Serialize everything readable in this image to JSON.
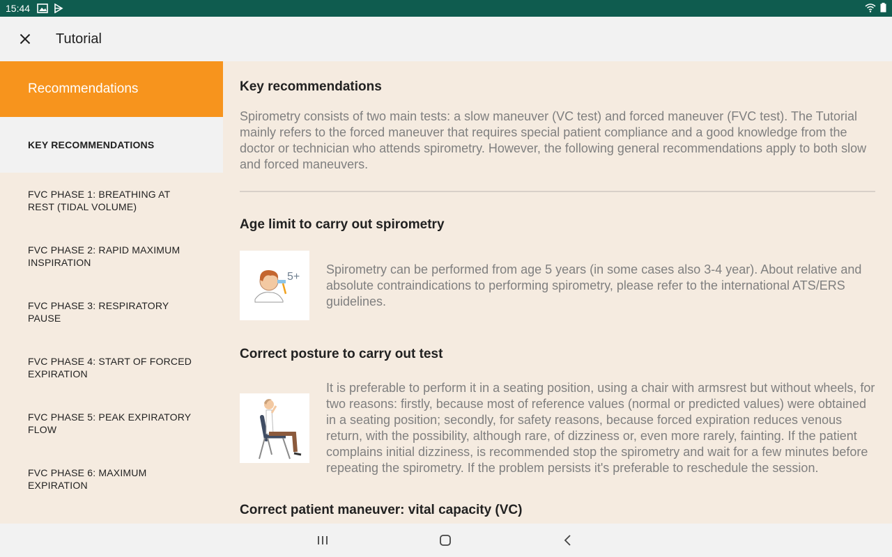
{
  "status_bar": {
    "time": "15:44"
  },
  "app_bar": {
    "title": "Tutorial"
  },
  "sidebar": {
    "header": "Recommendations",
    "items": [
      {
        "label": "KEY RECOMMENDATIONS",
        "active": true
      },
      {
        "label": "FVC PHASE 1: BREATHING AT REST (TIDAL VOLUME)"
      },
      {
        "label": "FVC PHASE 2: RAPID MAXIMUM INSPIRATION"
      },
      {
        "label": "FVC PHASE 3: RESPIRATORY PAUSE"
      },
      {
        "label": "FVC PHASE 4: START OF FORCED EXPIRATION"
      },
      {
        "label": "FVC PHASE 5: PEAK EXPIRATORY FLOW"
      },
      {
        "label": "FVC PHASE 6: MAXIMUM EXPIRATION"
      }
    ]
  },
  "content": {
    "title": "Key recommendations",
    "intro": "Spirometry consists of two main tests: a slow maneuver (VC test) and forced maneuver (FVC test). The Tutorial mainly refers to the forced maneuver that requires special patient compliance and a good knowledge from the doctor or technician who attends spirometry. However, the following general recommendations apply to both slow and forced maneuvers.",
    "sections": [
      {
        "title": "Age limit to carry out spirometry",
        "image_label": "5+",
        "text": "Spirometry can be performed from age 5 years (in some cases also 3-4 year). About relative and absolute contraindications to performing spirometry, please refer to the international ATS/ERS guidelines."
      },
      {
        "title": "Correct posture to carry out test",
        "text": "It is preferable to perform it in a seating position, using a chair with armsrest but without wheels, for two reasons: firstly, because most of reference values (normal or predicted values) were obtained in a seating position; secondly, for safety reasons, because forced expiration reduces venous return, with the possibility, although rare, of dizziness or, even more rarely, fainting. If the patient complains initial dizziness, is recommended stop the spirometry and wait for a few minutes before repeating the spirometry. If the problem persists it's preferable to reschedule the session."
      },
      {
        "title": "Correct patient maneuver: vital capacity (VC)"
      }
    ]
  },
  "colors": {
    "status_bar": "#0f5c4f",
    "accent": "#f7941d",
    "background": "#f5ebe0"
  }
}
